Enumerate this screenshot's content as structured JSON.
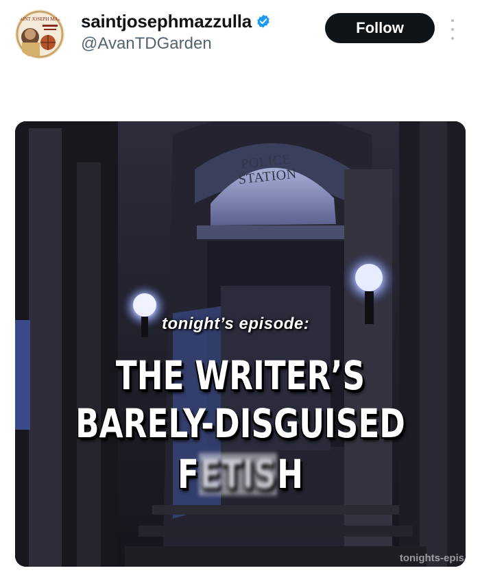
{
  "tweet": {
    "display_name": "saintjosephmazzulla",
    "handle": "@AvanTDGarden",
    "follow_label": "Follow",
    "verified": true,
    "avatar_text": "SAINT JOSEPH MAZZULLA"
  },
  "media": {
    "sign_text": "POLICE STATION",
    "intro_text": "tonight’s episode:",
    "title_line_1": "THE WRITER’S",
    "title_line_2": "BARELY-DISGUISED",
    "title_line_3_start": "F",
    "title_line_3_blurred": "ETIS",
    "title_line_3_end": "H",
    "watermark": "tonights-epis"
  },
  "colors": {
    "follow_bg": "#0f1419",
    "verified": "#1d9bf0",
    "handle": "#536471",
    "name": "#0f1419"
  },
  "icons": {
    "verified": "verified-badge-icon",
    "more": "more-options-icon"
  }
}
